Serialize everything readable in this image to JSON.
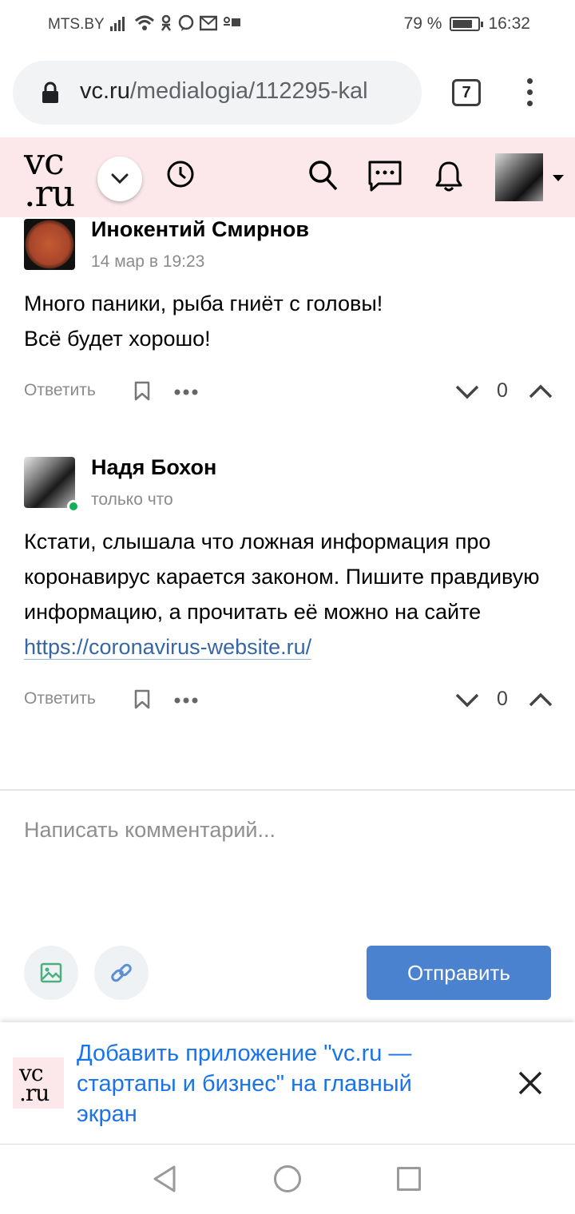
{
  "status_bar": {
    "carrier": "MTS.BY",
    "battery": "79 %",
    "battery_level": 0.79,
    "time": "16:32"
  },
  "browser": {
    "url_host": "vc.ru",
    "url_path": "/medialogia/112295-kal",
    "tab_count": "7"
  },
  "site_header": {
    "logo_line1": "vc",
    "logo_line2": ".ru",
    "icons": [
      "chevron-down-icon",
      "clock-icon",
      "search-icon",
      "chat-icon",
      "bell-icon"
    ]
  },
  "comments": [
    {
      "author": "Инокентий Смирнов",
      "time": "14 мар в 19:23",
      "text_line1": "Много паники, рыба гниёт с головы!",
      "text_line2": "Всё будет хорошо!",
      "reply": "Ответить",
      "votes": "0"
    },
    {
      "author": "Надя Бохон",
      "time": "только что",
      "text": "Кстати, слышала что ложная информация про коронавирус карается законом. Пишите правдивую информацию, а прочитать её можно на сайте ",
      "link": "https://coronavirus-website.ru/",
      "reply": "Ответить",
      "votes": "0"
    }
  ],
  "compose": {
    "placeholder": "Написать комментарий...",
    "send_label": "Отправить"
  },
  "install_banner": {
    "logo_line1": "vc",
    "logo_line2": ".ru",
    "text": "Добавить приложение \"vc.ru — стартапы и бизнес\" на главный экран"
  },
  "colors": {
    "header_bg": "#fce8ea",
    "send_button": "#4a82d0",
    "link": "#3566a8",
    "banner_text": "#1a73e8",
    "online": "#13b057"
  }
}
